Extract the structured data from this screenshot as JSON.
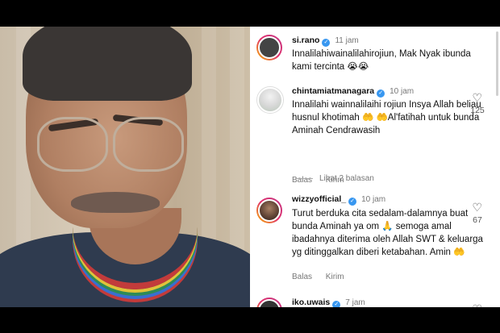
{
  "comments": [
    {
      "username": "si.rano",
      "time": "11 jam",
      "text": "Innalilahiwainalilahirojiun, Mak Nyak ibunda kami tercinta 😭😭",
      "likes": ""
    },
    {
      "username": "chintamiatmanagara",
      "time": "10 jam",
      "text": "Innalilahi wainnalilaihi rojiun Insya Allah beliau husnul khotimah 🤲 🤲Al'fatihah untuk bunda Aminah Cendrawasih",
      "likes": "125",
      "reply_label": "Balas",
      "send_label": "Kirim",
      "view_replies": "Lihat 2 balasan"
    },
    {
      "username": "wizzyofficial_",
      "time": "10 jam",
      "text": "Turut berduka cita sedalam-dalamnya buat bunda Aminah ya om 🙏 semoga amal ibadahnya diterima oleh Allah SWT & keluarga yg ditinggalkan diberi ketabahan. Amin 🤲",
      "likes": "67",
      "reply_label": "Balas",
      "send_label": "Kirim"
    },
    {
      "username": "iko.uwais",
      "time": "7 jam",
      "text": "",
      "likes": ""
    }
  ],
  "icons": {
    "verified": "verified-badge-icon",
    "like": "heart-icon"
  }
}
